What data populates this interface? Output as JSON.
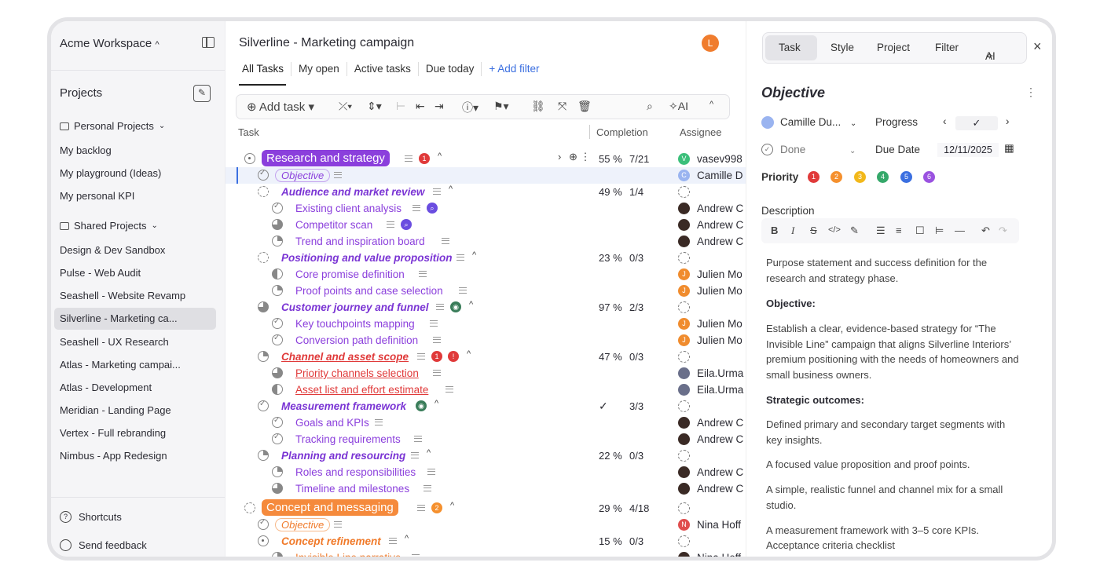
{
  "sidebar": {
    "workspace": "Acme Workspace",
    "projects_heading": "Projects",
    "personal_group": "Personal Projects",
    "personal_items": [
      "My backlog",
      "My playground (Ideas)",
      "My personal KPI"
    ],
    "shared_group": "Shared Projects",
    "shared_items": [
      "Design & Dev Sandbox",
      "Pulse - Web Audit",
      "Seashell - Website Revamp",
      "Silverline - Marketing ca...",
      "Seashell - UX Research",
      "Atlas - Marketing campai...",
      "Atlas - Development",
      "Meridian - Landing Page",
      "Vertex - Full rebranding",
      "Nimbus - App Redesign"
    ],
    "footer": {
      "shortcuts": "Shortcuts",
      "feedback": "Send feedback"
    }
  },
  "main": {
    "title": "Silverline - Marketing campaign",
    "user_initial": "L",
    "tabs": [
      "All Tasks",
      "My open",
      "Active tasks",
      "Due today"
    ],
    "add_filter": "+ Add filter",
    "toolbar": {
      "add_task": "Add task",
      "ai": "AI"
    },
    "columns": {
      "task": "Task",
      "completion": "Completion",
      "assignee": "Assignee"
    }
  },
  "rows": [
    {
      "name": "Research and strategy",
      "pct": "55 %",
      "count": "7/21",
      "assignee": "vasev998",
      "av": "V"
    },
    {
      "name": "Objective",
      "assignee": "Camille D",
      "av": "C"
    },
    {
      "name": "Audience and market review",
      "pct": "49 %",
      "count": "1/4"
    },
    {
      "name": "Existing client analysis",
      "assignee": "Andrew C"
    },
    {
      "name": "Competitor scan",
      "assignee": "Andrew C"
    },
    {
      "name": "Trend and inspiration board",
      "assignee": "Andrew C"
    },
    {
      "name": "Positioning and value proposition",
      "pct": "23 %",
      "count": "0/3"
    },
    {
      "name": "Core promise definition",
      "assignee": "Julien Mo",
      "av": "J"
    },
    {
      "name": "Proof points and case selection",
      "assignee": "Julien Mo",
      "av": "J"
    },
    {
      "name": "Customer journey and funnel",
      "pct": "97 %",
      "count": "2/3"
    },
    {
      "name": "Key touchpoints mapping",
      "assignee": "Julien Mo",
      "av": "J"
    },
    {
      "name": "Conversion path definition",
      "assignee": "Julien Mo",
      "av": "J"
    },
    {
      "name": "Channel and asset scope",
      "pct": "47 %",
      "count": "0/3"
    },
    {
      "name": "Priority channels selection",
      "assignee": "Eila.Urma"
    },
    {
      "name": "Asset list and effort estimate",
      "assignee": "Eila.Urma"
    },
    {
      "name": "Measurement framework",
      "pct": "✓",
      "count": "3/3"
    },
    {
      "name": "Goals and KPIs",
      "assignee": "Andrew C"
    },
    {
      "name": "Tracking requirements",
      "assignee": "Andrew C"
    },
    {
      "name": "Planning and resourcing",
      "pct": "22 %",
      "count": "0/3"
    },
    {
      "name": "Roles and responsibilities",
      "assignee": "Andrew C"
    },
    {
      "name": "Timeline and milestones",
      "assignee": "Andrew C"
    },
    {
      "name": "Concept and messaging",
      "pct": "29 %",
      "count": "4/18"
    },
    {
      "name": "Objective",
      "assignee": "Nina Hoff",
      "av": "N"
    },
    {
      "name": "Concept refinement",
      "pct": "15 %",
      "count": "0/3"
    },
    {
      "name": "Invisible Line narrative",
      "assignee": "Nina Hoff"
    }
  ],
  "badges": {
    "r0": "1",
    "r12a": "1",
    "r12b": "!",
    "r21": "2"
  },
  "panel": {
    "tabs": [
      "Task",
      "Style",
      "Project",
      "Filter",
      "AI"
    ],
    "title": "Objective",
    "assignee": "Camille Du...",
    "progress_label": "Progress",
    "status": "Done",
    "due_label": "Due Date",
    "due_date": "12/11/2025",
    "priority_label": "Priority",
    "priorities": [
      "1",
      "2",
      "3",
      "4",
      "5",
      "6"
    ],
    "description_label": "Description",
    "paragraphs": [
      {
        "text": "Purpose statement and success definition for the research and strategy phase.",
        "bold": false
      },
      {
        "text": "Objective:",
        "bold": true
      },
      {
        "text": "Establish a clear, evidence-based strategy for “The Invisible Line” campaign that aligns Silverline Interiors’ premium positioning with the needs of homeowners and small business owners.",
        "bold": false
      },
      {
        "text": "Strategic outcomes:",
        "bold": true
      },
      {
        "text": "Defined primary and secondary target segments with key insights.",
        "bold": false
      },
      {
        "text": "A focused value proposition and proof points.",
        "bold": false
      },
      {
        "text": "A simple, realistic funnel and channel mix for a small studio.",
        "bold": false
      },
      {
        "text": "A measurement framework with 3–5 core KPIs.",
        "bold": false
      },
      {
        "text": "Acceptance criteria checklist",
        "bold": false
      }
    ]
  },
  "colors": {
    "purple": "#8b3fdc",
    "orange": "#f58a3c",
    "red": "#e03a3a",
    "accent_blue": "#3b6fe0"
  }
}
